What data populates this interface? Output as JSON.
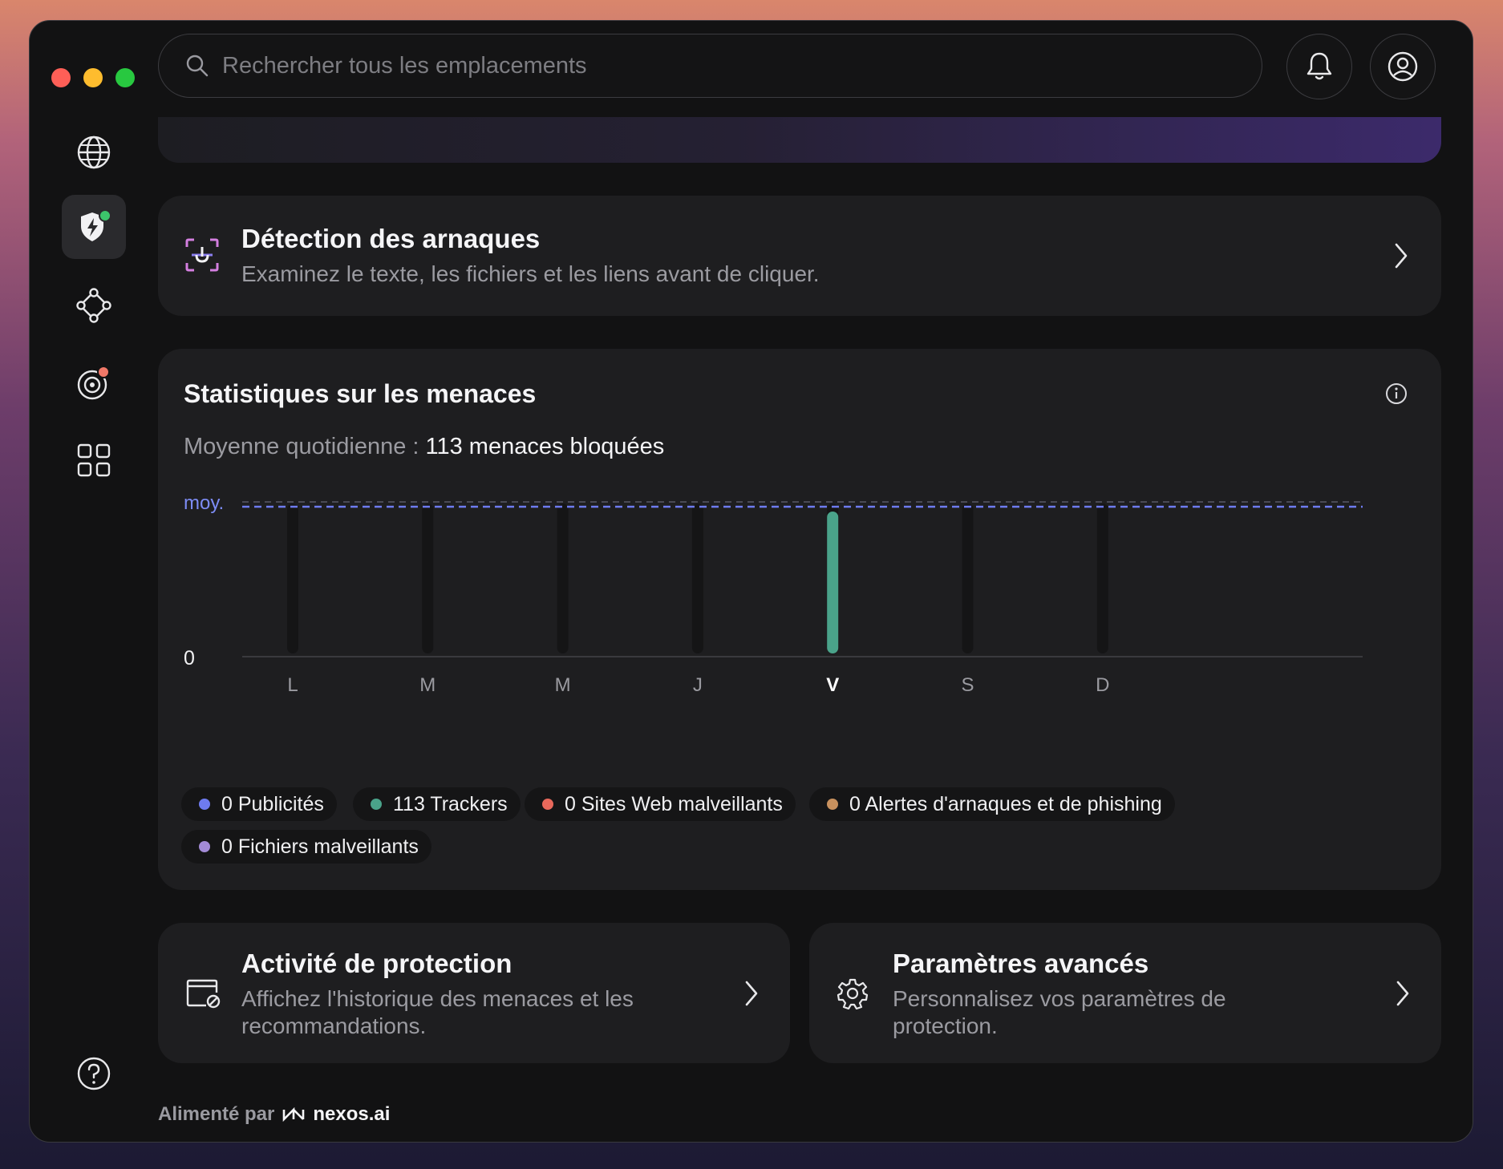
{
  "search": {
    "placeholder": "Rechercher tous les emplacements"
  },
  "scam_card": {
    "title": "Détection des arnaques",
    "subtitle": "Examinez le texte, les fichiers et les liens avant de cliquer."
  },
  "stats": {
    "title": "Statistiques sur les menaces",
    "avg_label": "Moyenne quotidienne : ",
    "avg_value": "113 menaces bloquées",
    "avg_line_label": "moy.",
    "zero_label": "0"
  },
  "chart_data": {
    "type": "bar",
    "categories": [
      "L",
      "M",
      "M",
      "J",
      "V",
      "S",
      "D"
    ],
    "values": [
      0,
      0,
      0,
      0,
      113,
      0,
      0
    ],
    "average": 113,
    "highlight_index": 4,
    "bar_color": "#4aa38a",
    "average_line_color": "#6e7bf0"
  },
  "legend": [
    {
      "label": "0 Publicités",
      "color": "#6e7bf0"
    },
    {
      "label": "113 Trackers",
      "color": "#4aa38a"
    },
    {
      "label": "0 Sites Web malveillants",
      "color": "#e8685b"
    },
    {
      "label": "0 Alertes d'arnaques et de phishing",
      "color": "#c8915e"
    },
    {
      "label": "0 Fichiers malveillants",
      "color": "#a38bd6"
    }
  ],
  "activity_card": {
    "title": "Activité de protection",
    "subtitle_line1": "Affichez l'historique des menaces et les",
    "subtitle_line2": "recommandations."
  },
  "advanced_card": {
    "title": "Paramètres avancés",
    "subtitle_line1": "Personnalisez vos paramètres de",
    "subtitle_line2": "protection."
  },
  "footer": {
    "prefix": "Alimenté par",
    "brand": "nexos.ai"
  },
  "icons": {
    "sidebar": [
      "globe-icon",
      "shield-icon",
      "mesh-network-icon",
      "target-icon",
      "apps-grid-icon",
      "help-icon"
    ],
    "header": [
      "search-icon",
      "bell-icon",
      "user-icon"
    ]
  }
}
